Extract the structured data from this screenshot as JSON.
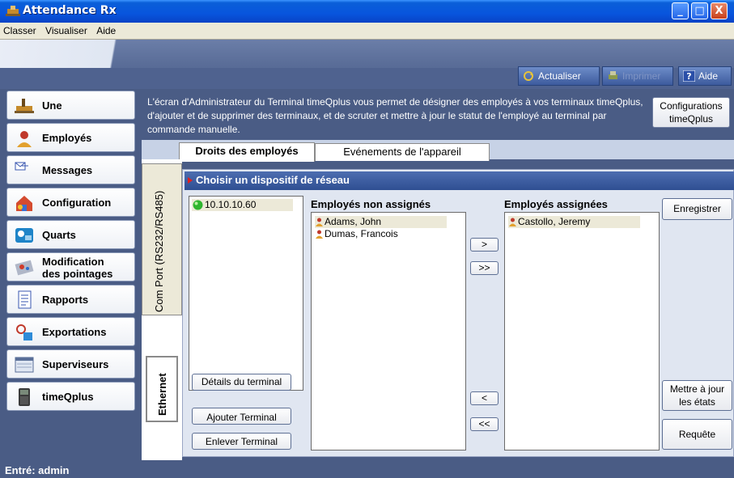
{
  "window": {
    "title": "Attendance Rx",
    "controls": {
      "minimize": "_",
      "maximize": "□",
      "close": "X"
    }
  },
  "menu": [
    "Classer",
    "Visualiser",
    "Aide"
  ],
  "toolbar": {
    "refresh_label": "Actualiser",
    "print_label": "Imprimer",
    "help_label": "Aide"
  },
  "sidebar": {
    "items": [
      {
        "label": "Une",
        "icon": "shovel-icon"
      },
      {
        "label": "Employés",
        "icon": "employee-icon"
      },
      {
        "label": "Messages",
        "icon": "messages-icon"
      },
      {
        "label": "Configuration",
        "icon": "configuration-icon"
      },
      {
        "label": "Quarts",
        "icon": "shifts-icon"
      },
      {
        "label": "Modification",
        "label2": "des pointages",
        "icon": "punch-edit-icon"
      },
      {
        "label": "Rapports",
        "icon": "reports-icon"
      },
      {
        "label": "Exportations",
        "icon": "exports-icon"
      },
      {
        "label": "Superviseurs",
        "icon": "supervisors-icon"
      },
      {
        "label": "timeQplus",
        "icon": "terminal-icon"
      }
    ],
    "active_index": 9
  },
  "description": "L'écran d'Administrateur du Terminal timeQplus vous permet de désigner des employés à vos terminaux timeQplus, d'ajouter et de supprimer des terminaux, et de scruter et mettre à jour le statut de l'employé au terminal par commande manuelle.",
  "config_button": {
    "line1": "Configurations",
    "line2": "timeQplus"
  },
  "tabs": [
    {
      "label": "Droits des employés",
      "active": true
    },
    {
      "label": "Evénements de l'appareil",
      "active": false
    }
  ],
  "vertical_tabs": [
    {
      "label": "Com Port (RS232/RS485)",
      "active": false
    },
    {
      "label": "Ethernet",
      "active": true
    }
  ],
  "panel": {
    "header": "Choisir un dispositif de réseau",
    "devices": [
      "10.10.10.60"
    ],
    "device_status_color": "#2fb52f",
    "unassigned_header": "Employés non assignés",
    "unassigned": [
      "Adams, John",
      "Dumas, Francois"
    ],
    "assigned_header": "Employés assignées",
    "assigned": [
      "Castollo, Jeremy"
    ],
    "move_right": ">",
    "move_all_right": ">>",
    "move_left": "<",
    "move_all_left": "<<",
    "details_button": "Détails du terminal",
    "add_button": "Ajouter Terminal",
    "remove_button": "Enlever Terminal",
    "save_button": "Enregistrer",
    "update_button_line1": "Mettre à jour",
    "update_button_line2": "les états",
    "query_button": "Requête"
  },
  "status": "Entré: admin",
  "colors": {
    "title_bar": "#0855dd",
    "app_background": "#4a5c85",
    "panel_header": "#2f4f92",
    "selected_item": "#ece9d8"
  }
}
